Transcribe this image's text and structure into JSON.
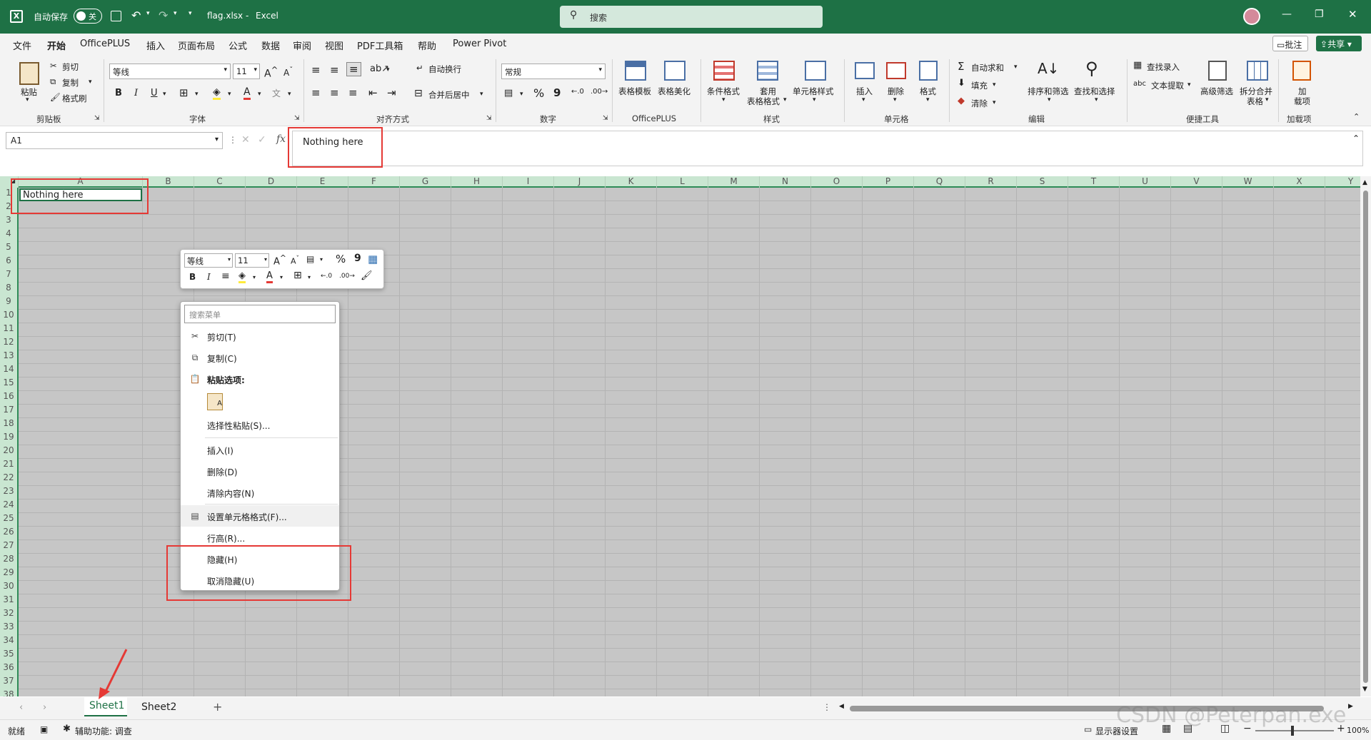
{
  "titlebar": {
    "autosave_label": "自动保存",
    "autosave_state": "关",
    "filename": "flag.xlsx",
    "separator": "-",
    "app_name": "Excel",
    "search_placeholder": "搜索"
  },
  "tabs": [
    "文件",
    "开始",
    "OfficePLUS",
    "插入",
    "页面布局",
    "公式",
    "数据",
    "审阅",
    "视图",
    "PDF工具箱",
    "帮助",
    "Power Pivot"
  ],
  "active_tab": "开始",
  "top_right": {
    "comments": "批注",
    "share": "共享"
  },
  "ribbon": {
    "clipboard": {
      "paste": "粘贴",
      "cut": "剪切",
      "copy": "复制",
      "format_painter": "格式刷",
      "group": "剪贴板"
    },
    "font": {
      "family": "等线",
      "size": "11",
      "group": "字体"
    },
    "alignment": {
      "wrap": "自动换行",
      "merge": "合并后居中",
      "group": "对齐方式"
    },
    "number": {
      "format": "常规",
      "percent": "%",
      "comma": "9",
      "group": "数字"
    },
    "officeplus": {
      "table_template": "表格模板",
      "table_beautify": "表格美化",
      "group": "OfficePLUS"
    },
    "styles": {
      "conditional": "条件格式",
      "as_table_1": "套用",
      "as_table_2": "表格格式",
      "cell_styles": "单元格样式",
      "group": "样式"
    },
    "cells": {
      "insert": "插入",
      "delete": "删除",
      "format": "格式",
      "group": "单元格"
    },
    "editing": {
      "autosum": "自动求和",
      "fill": "填充",
      "clear": "清除",
      "sort_filter": "排序和筛选",
      "find_select": "查找和选择",
      "group": "编辑"
    },
    "tools": {
      "lookup": "查找录入",
      "text_extract": "文本提取",
      "advanced_filter": "高级筛选",
      "split_merge_1": "拆分合并",
      "split_merge_2": "表格",
      "group": "便捷工具"
    },
    "addins": {
      "addins_1": "加",
      "addins_2": "载项",
      "group": "加载项"
    }
  },
  "formula_bar": {
    "name_box": "A1",
    "fx": "fx",
    "content": "Nothing here"
  },
  "columns": [
    "A",
    "B",
    "C",
    "D",
    "E",
    "F",
    "G",
    "H",
    "I",
    "J",
    "K",
    "L",
    "M",
    "N",
    "O",
    "P",
    "Q",
    "R",
    "S",
    "T",
    "U",
    "V",
    "W",
    "X",
    "Y"
  ],
  "rows": [
    "1",
    "2",
    "3",
    "4",
    "5",
    "6",
    "7",
    "8",
    "9",
    "10",
    "11",
    "12",
    "13",
    "14",
    "15",
    "16",
    "17",
    "18",
    "19",
    "20",
    "21",
    "22",
    "23",
    "24",
    "25",
    "26",
    "27",
    "28",
    "29",
    "30",
    "31",
    "32",
    "33",
    "34",
    "35",
    "36",
    "37",
    "38"
  ],
  "cell_A1": "Nothing here",
  "mini_toolbar": {
    "font": "等线",
    "size": "11",
    "percent": "%",
    "comma": "9",
    "bold": "B",
    "italic": "I"
  },
  "context_menu": {
    "search_placeholder": "搜索菜单",
    "cut": "剪切(T)",
    "copy": "复制(C)",
    "paste_options": "粘贴选项:",
    "paste_special": "选择性粘贴(S)...",
    "insert": "插入(I)",
    "delete": "删除(D)",
    "clear_contents": "清除内容(N)",
    "format_cells": "设置单元格格式(F)...",
    "row_height": "行高(R)...",
    "hide": "隐藏(H)",
    "unhide": "取消隐藏(U)"
  },
  "sheets": [
    "Sheet1",
    "Sheet2"
  ],
  "active_sheet": "Sheet1",
  "status": {
    "ready": "就绪",
    "accessibility": "辅助功能: 调查",
    "display_settings": "显示器设置",
    "zoom": "100%"
  },
  "watermark": "CSDN @Peterpan.exe",
  "colors": {
    "excel_green": "#1e7145",
    "annotation_red": "#e53935"
  }
}
